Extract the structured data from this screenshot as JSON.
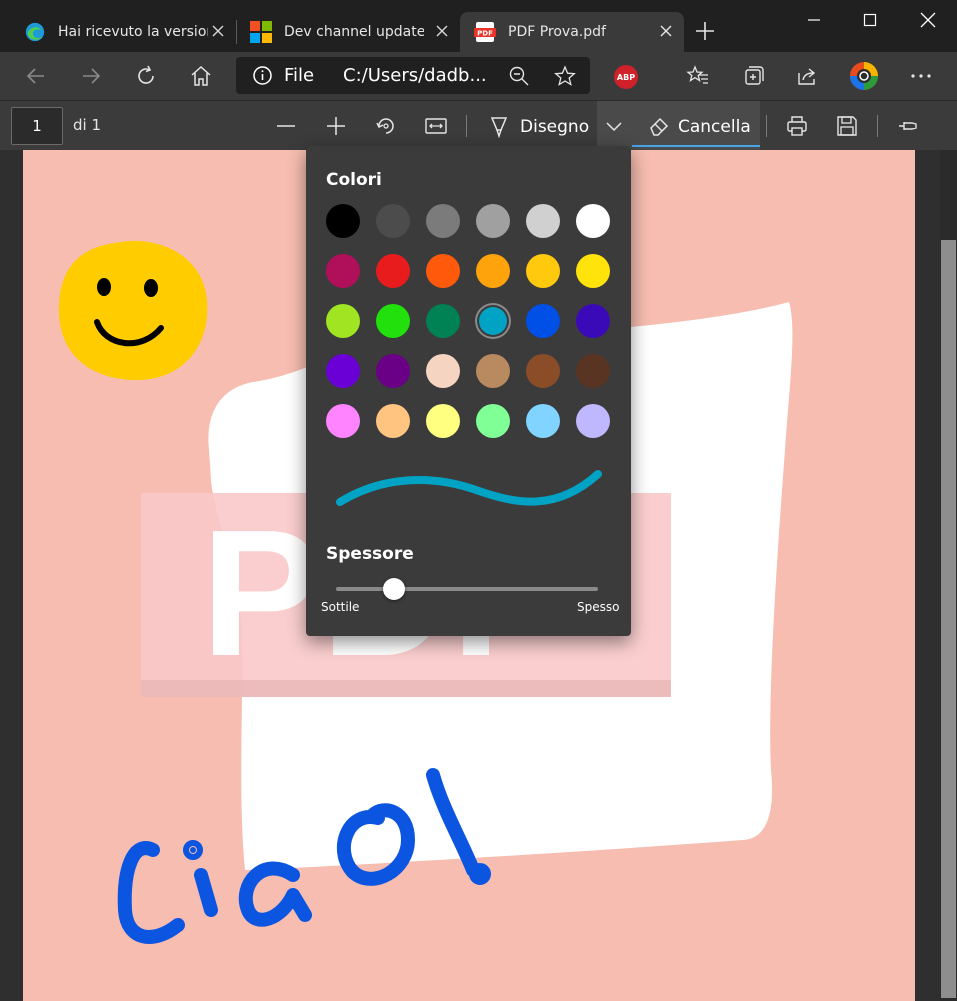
{
  "tabs": [
    {
      "title": "Hai ricevuto la version",
      "icon": "edge-icon",
      "active": false
    },
    {
      "title": "Dev channel update t",
      "icon": "microsoft-logo-icon",
      "active": false
    },
    {
      "title": "PDF Prova.pdf",
      "icon": "pdf-icon",
      "active": true
    }
  ],
  "address": {
    "scheme_label": "File",
    "url": "C:/Users/dadb..."
  },
  "extensions": {
    "abp_label": "ABP"
  },
  "pdf_toolbar": {
    "page_number": "1",
    "page_count": "di 1",
    "draw_label": "Disegno",
    "erase_label": "Cancella"
  },
  "colors_panel": {
    "title": "Colori",
    "thickness_title": "Spessore",
    "thin_label": "Sottile",
    "thick_label": "Spesso",
    "thickness_value": 0.22,
    "selected_index": 15,
    "preview_color": "#00a3c4",
    "swatches": [
      "#000000",
      "#4c4c4c",
      "#7b7b7b",
      "#a0a0a0",
      "#d0d0d0",
      "#ffffff",
      "#b0105a",
      "#e81c1c",
      "#ff5a0c",
      "#ffa30d",
      "#ffc90e",
      "#ffe30a",
      "#a0e422",
      "#22e00b",
      "#008254",
      "#00a3c4",
      "#0050e8",
      "#3b0ab8",
      "#6b00d6",
      "#6a0086",
      "#f6d4c2",
      "#b98a5f",
      "#8a4d27",
      "#5a3422",
      "#ff84ff",
      "#ffc480",
      "#ffff80",
      "#80ff96",
      "#80d4ff",
      "#c0b8ff"
    ]
  },
  "document": {
    "background_color": "#f6bdb0",
    "pdf_text": "PDF"
  }
}
